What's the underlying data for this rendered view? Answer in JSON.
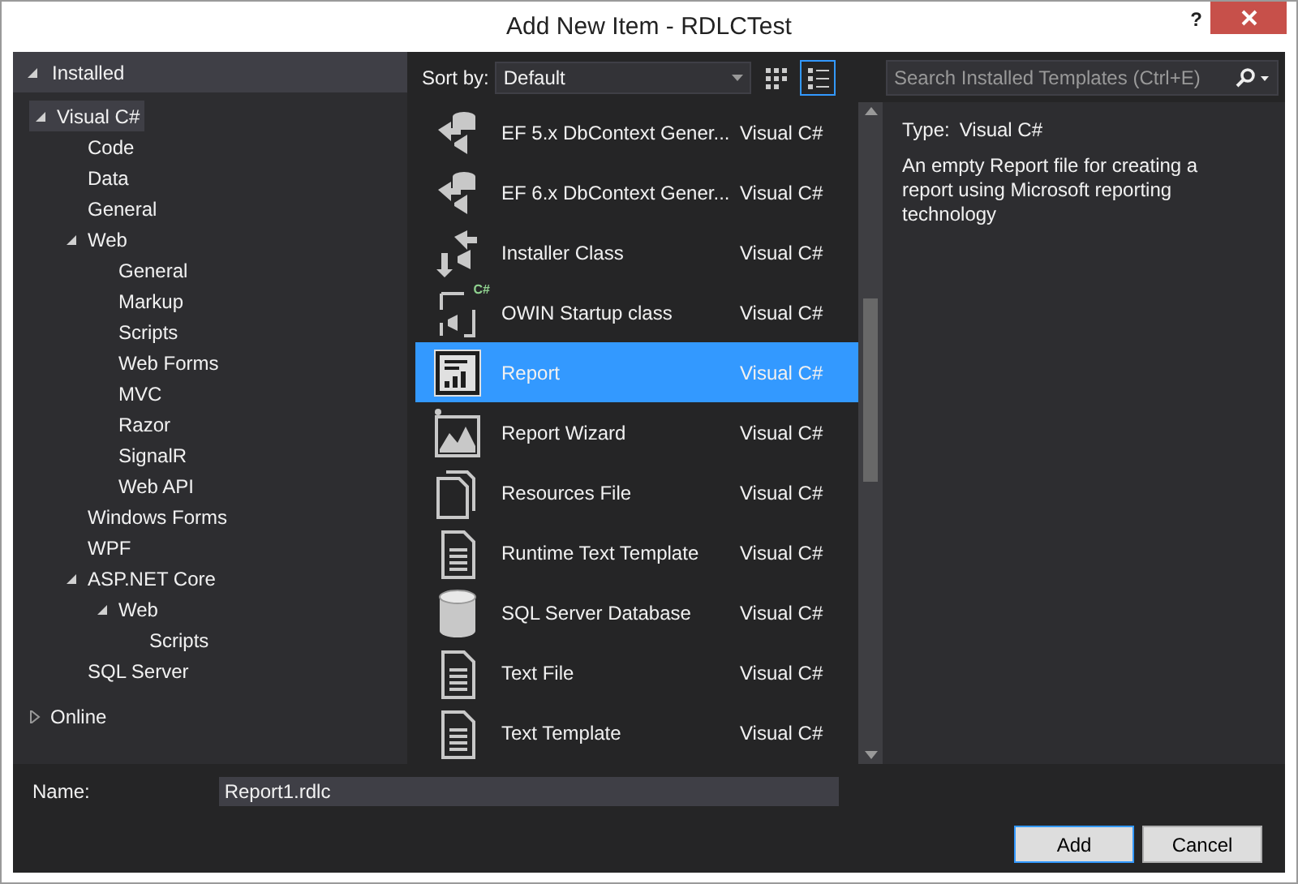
{
  "window": {
    "title": "Add New Item - RDLCTest",
    "help": "?"
  },
  "sidebar": {
    "sections": [
      {
        "label": "Installed",
        "expanded": true,
        "header": true,
        "children": [
          {
            "label": "Visual C#",
            "expanded": true,
            "selected": true,
            "children": [
              {
                "label": "Code",
                "selected": false
              },
              {
                "label": "Data",
                "selected": false
              },
              {
                "label": "General",
                "selected": false
              },
              {
                "label": "Web",
                "expanded": true,
                "selected": false,
                "children": [
                  {
                    "label": "General",
                    "selected": false
                  },
                  {
                    "label": "Markup",
                    "selected": false
                  },
                  {
                    "label": "Scripts",
                    "selected": false
                  },
                  {
                    "label": "Web Forms",
                    "selected": false
                  },
                  {
                    "label": "MVC",
                    "selected": false
                  },
                  {
                    "label": "Razor",
                    "selected": false
                  },
                  {
                    "label": "SignalR",
                    "selected": false
                  },
                  {
                    "label": "Web API",
                    "selected": false
                  }
                ]
              },
              {
                "label": "Windows Forms",
                "selected": false
              },
              {
                "label": "WPF",
                "selected": false
              },
              {
                "label": "ASP.NET Core",
                "expanded": true,
                "selected": false,
                "children": [
                  {
                    "label": "Web",
                    "expanded": true,
                    "selected": false,
                    "children": [
                      {
                        "label": "Scripts",
                        "selected": false
                      }
                    ]
                  }
                ]
              },
              {
                "label": "SQL Server",
                "selected": false
              }
            ]
          }
        ]
      },
      {
        "label": "Online",
        "expanded": false,
        "header": false
      }
    ]
  },
  "toolbar": {
    "sort_label": "Sort by:",
    "sort_value": "Default",
    "view_modes": [
      {
        "kind": "grid",
        "selected": false
      },
      {
        "kind": "list",
        "selected": true
      }
    ],
    "search_placeholder": "Search Installed Templates (Ctrl+E)"
  },
  "templates": [
    {
      "kind": "ef",
      "name": "EF 5.x DbContext Gener...",
      "type": "Visual C#",
      "selected": false
    },
    {
      "kind": "ef",
      "name": "EF 6.x DbContext Gener...",
      "type": "Visual C#",
      "selected": false
    },
    {
      "kind": "installer",
      "name": "Installer Class",
      "type": "Visual C#",
      "selected": false
    },
    {
      "kind": "owin",
      "name": "OWIN Startup class",
      "type": "Visual C#",
      "selected": false,
      "icon_badge": "C#"
    },
    {
      "kind": "report",
      "name": "Report",
      "type": "Visual C#",
      "selected": true
    },
    {
      "kind": "wizard",
      "name": "Report Wizard",
      "type": "Visual C#",
      "selected": false
    },
    {
      "kind": "resources",
      "name": "Resources File",
      "type": "Visual C#",
      "selected": false
    },
    {
      "kind": "text",
      "name": "Runtime Text Template",
      "type": "Visual C#",
      "selected": false
    },
    {
      "kind": "database",
      "name": "SQL Server Database",
      "type": "Visual C#",
      "selected": false
    },
    {
      "kind": "text",
      "name": "Text File",
      "type": "Visual C#",
      "selected": false
    },
    {
      "kind": "text",
      "name": "Text Template",
      "type": "Visual C#",
      "selected": false
    }
  ],
  "details": {
    "type_label": "Type:",
    "type_value": "Visual C#",
    "description": "An empty Report file for creating a report using Microsoft reporting technology"
  },
  "name_field": {
    "label": "Name:",
    "value": "Report1.rdlc"
  },
  "buttons": [
    {
      "label": "Add",
      "default": true
    },
    {
      "label": "Cancel",
      "default": false
    }
  ]
}
